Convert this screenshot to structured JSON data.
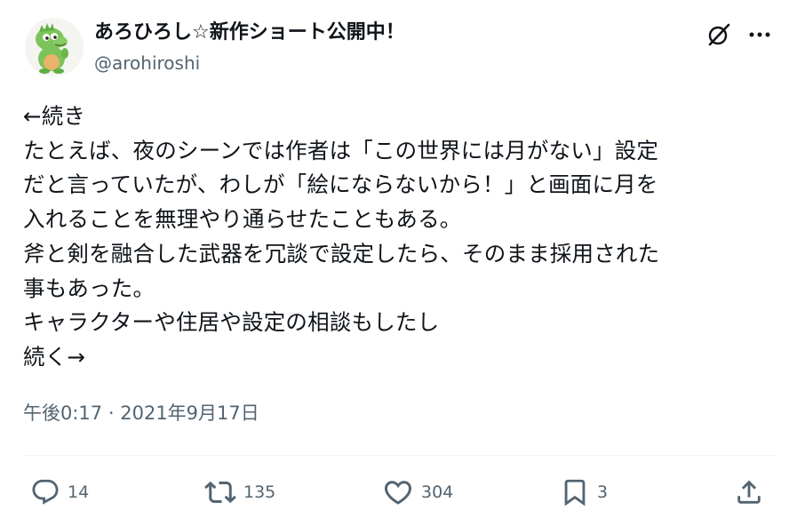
{
  "author": {
    "name": "あろひろし☆新作ショート公開中！",
    "handle": "@arohiroshi"
  },
  "tweet": {
    "lines": [
      "←続き",
      "たとえば、夜のシーンでは作者は「この世界には月がない」設定",
      "だと言っていたが、わしが「絵にならないから！」と画面に月を",
      "入れることを無理やり通らせたこともある。",
      "斧と剣を融合した武器を冗談で設定したら、そのまま採用された",
      "事もあった。",
      "キャラクターや住居や設定の相談もしたし",
      "続く→"
    ],
    "time": "午後0:17",
    "separator": "·",
    "date": "2021年9月17日"
  },
  "actions": {
    "reply_count": "14",
    "retweet_count": "135",
    "like_count": "304",
    "bookmark_count": "3"
  },
  "icons": {
    "grok": "grok-icon",
    "more": "more-icon",
    "reply": "reply-icon",
    "retweet": "retweet-icon",
    "like": "heart-icon",
    "bookmark": "bookmark-icon",
    "share": "share-icon"
  },
  "colors": {
    "text": "#0f1419",
    "secondary": "#536471",
    "divider": "#eff3f4"
  }
}
